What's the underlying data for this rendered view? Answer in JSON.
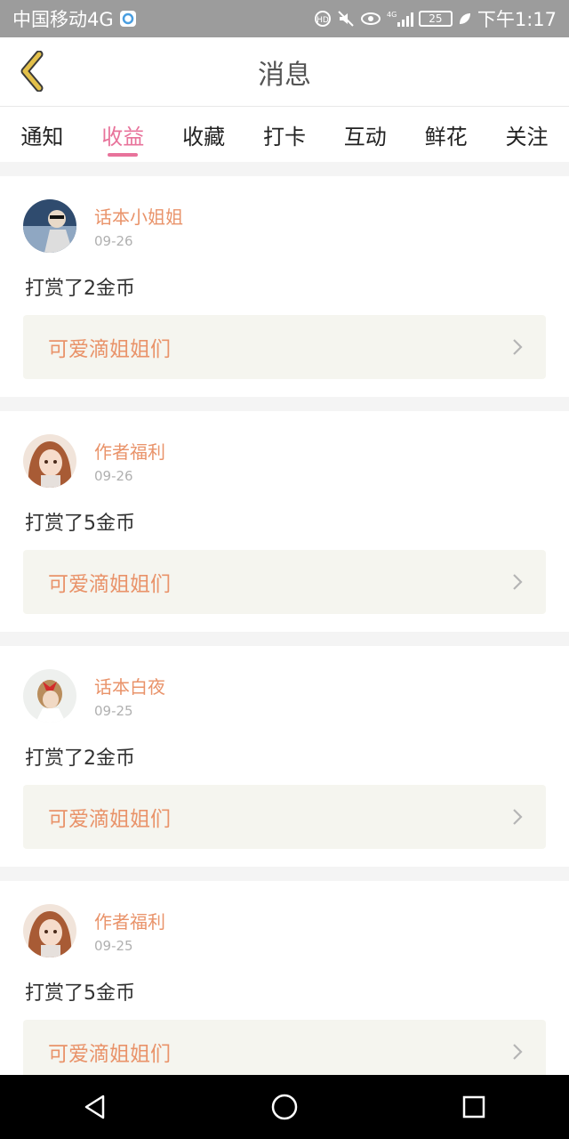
{
  "status_bar": {
    "carrier": "中国移动4G",
    "battery": "25",
    "time": "下午1:17",
    "icons": [
      "hd-call-icon",
      "mute-icon",
      "eye-icon",
      "signal-4g-icon",
      "battery-icon",
      "leaf-icon"
    ]
  },
  "header": {
    "title": "消息",
    "back_icon": "chevron-left-icon"
  },
  "tabs": [
    {
      "label": "通知",
      "active": false
    },
    {
      "label": "收益",
      "active": true
    },
    {
      "label": "收藏",
      "active": false
    },
    {
      "label": "打卡",
      "active": false
    },
    {
      "label": "互动",
      "active": false
    },
    {
      "label": "鲜花",
      "active": false
    },
    {
      "label": "关注",
      "active": false
    }
  ],
  "messages": [
    {
      "user": "话本小姐姐",
      "date": "09-26",
      "text": "打赏了2金币",
      "target": "可爱滴姐姐们"
    },
    {
      "user": "作者福利",
      "date": "09-26",
      "text": "打赏了5金币",
      "target": "可爱滴姐姐们"
    },
    {
      "user": "话本白夜",
      "date": "09-25",
      "text": "打赏了2金币",
      "target": "可爱滴姐姐们"
    },
    {
      "user": "作者福利",
      "date": "09-25",
      "text": "打赏了5金币",
      "target": "可爱滴姐姐们"
    }
  ],
  "colors": {
    "accent": "#e8739b",
    "name": "#e9936a",
    "link_bg": "#f5f5ef",
    "back_icon": "#e3c04a"
  },
  "nav": [
    "back-triangle-icon",
    "home-circle-icon",
    "recent-square-icon"
  ]
}
